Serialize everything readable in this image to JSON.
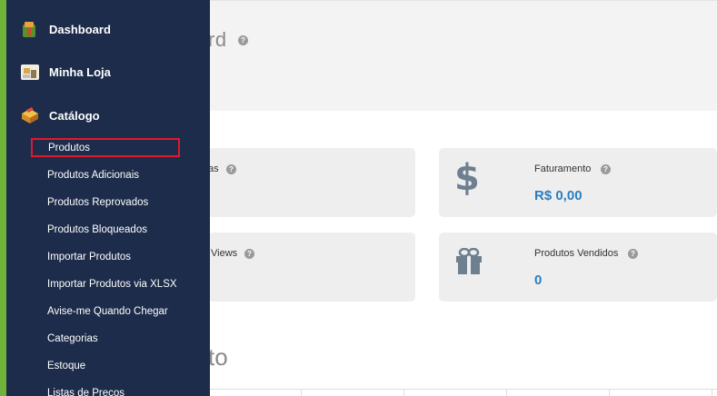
{
  "header": {
    "title_fragment": "rd"
  },
  "cards": [
    {
      "label_fragment": "as",
      "value": ""
    },
    {
      "label": "Faturamento",
      "value": "R$ 0,00",
      "icon": "dollar-icon"
    },
    {
      "label_fragment": "Views",
      "value": ""
    },
    {
      "label": "Produtos Vendidos",
      "value": "0",
      "icon": "gift-icon"
    }
  ],
  "section": {
    "title_fragment": "to"
  },
  "sidebar": {
    "items": [
      {
        "label": "Dashboard",
        "icon": "dashboard-icon"
      },
      {
        "label": "Minha Loja",
        "icon": "store-icon"
      },
      {
        "label": "Catálogo",
        "icon": "catalog-icon"
      }
    ],
    "catalog_subitems": [
      "Produtos",
      "Produtos Adicionais",
      "Produtos Reprovados",
      "Produtos Bloqueados",
      "Importar Produtos",
      "Importar Produtos via XLSX",
      "Avise-me Quando Chegar",
      "Categorias",
      "Estoque",
      "Listas de Preços"
    ],
    "selected_subitem": "Produtos"
  },
  "colors": {
    "sidebar_bg": "#1c2c4a",
    "sidebar_accent": "#6fb33a",
    "value_blue": "#2a7fc1",
    "selection_border": "#e0192b"
  }
}
